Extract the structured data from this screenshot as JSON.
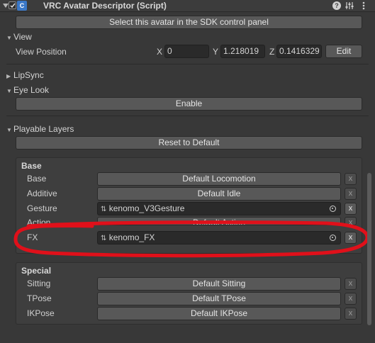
{
  "header": {
    "title": "VRC Avatar Descriptor (Script)",
    "icon_glyph": "C",
    "icons": [
      "help-icon",
      "preset-icon",
      "more-icon"
    ]
  },
  "select_button": "Select this avatar in the SDK control panel",
  "view": {
    "label": "View",
    "position_label": "View Position",
    "x_label": "X",
    "x_value": "0",
    "y_label": "Y",
    "y_value": "1.218019",
    "z_label": "Z",
    "z_value": "0.1416329",
    "edit_button": "Edit"
  },
  "lipsync": {
    "label": "LipSync"
  },
  "eyelook": {
    "label": "Eye Look",
    "enable_button": "Enable"
  },
  "playable_layers": {
    "label": "Playable Layers",
    "reset_button": "Reset to Default",
    "base": {
      "heading": "Base",
      "rows": [
        {
          "label": "Base",
          "value": "Default Locomotion",
          "custom": false
        },
        {
          "label": "Additive",
          "value": "Default Idle",
          "custom": false
        },
        {
          "label": "Gesture",
          "value": "kenomo_V3Gesture",
          "custom": true
        },
        {
          "label": "Action",
          "value": "Default Action",
          "custom": false
        },
        {
          "label": "FX",
          "value": "kenomo_FX",
          "custom": true
        }
      ]
    },
    "special": {
      "heading": "Special",
      "rows": [
        {
          "label": "Sitting",
          "value": "Default Sitting"
        },
        {
          "label": "TPose",
          "value": "Default TPose"
        },
        {
          "label": "IKPose",
          "value": "Default IKPose"
        }
      ]
    },
    "remove_glyph": "x"
  },
  "colors": {
    "background": "#383838",
    "annotation_circle": "#e0101a",
    "script_icon": "#3a78c8"
  }
}
